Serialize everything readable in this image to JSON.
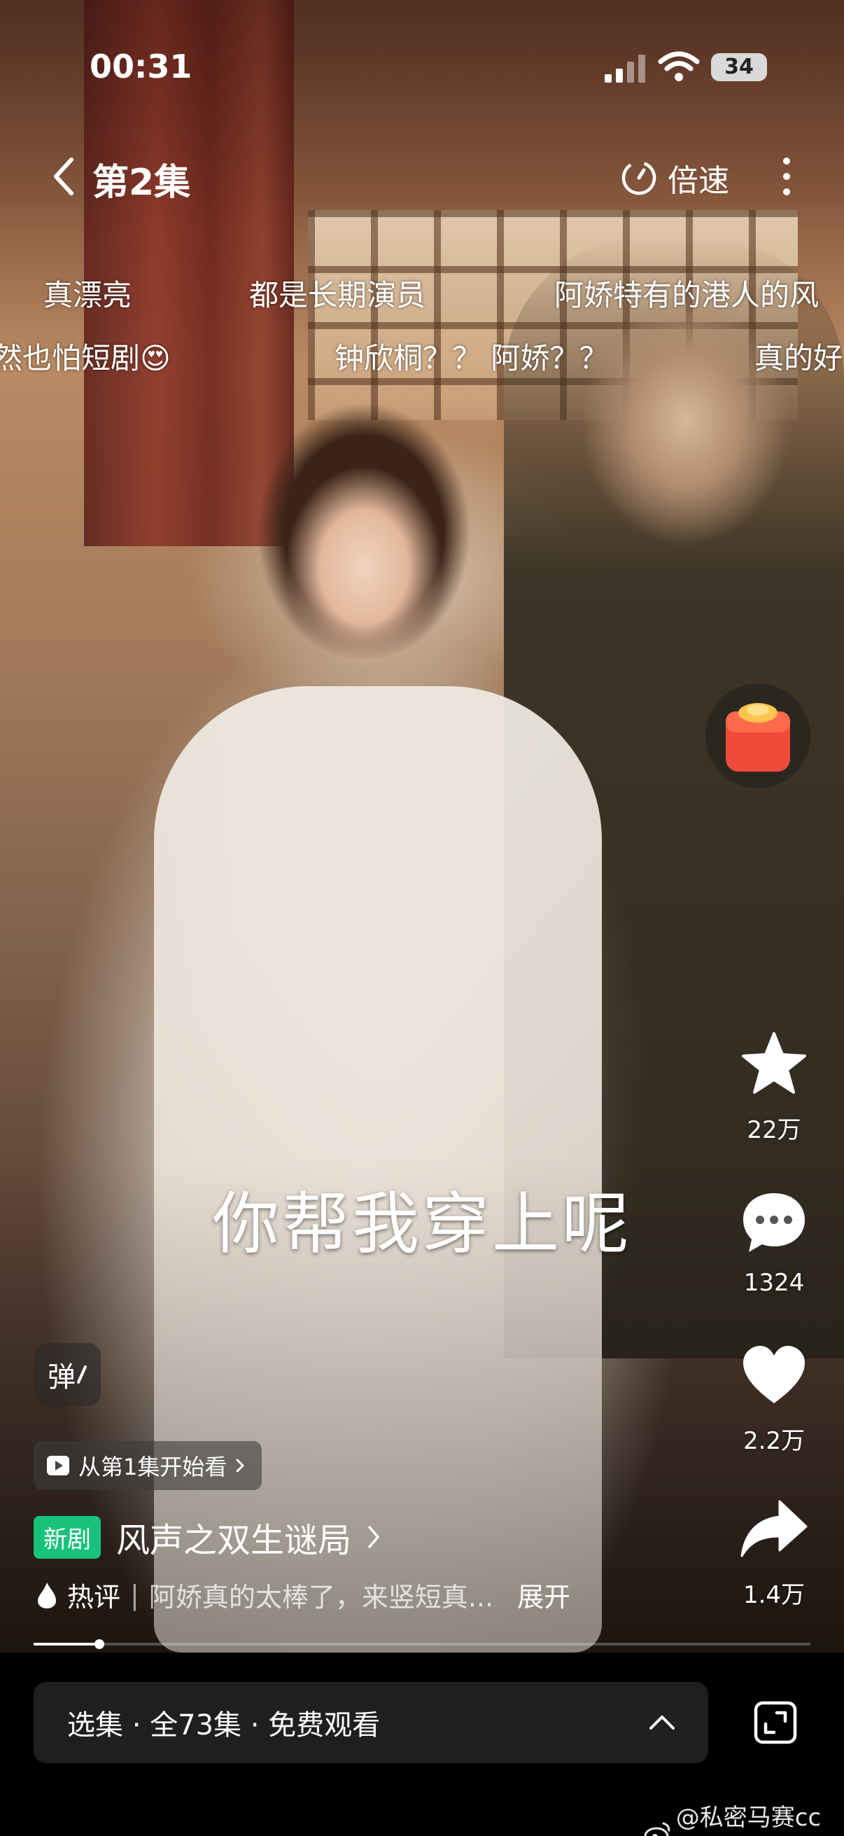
{
  "status_bar": {
    "time": "00:31",
    "battery": "34"
  },
  "top_bar": {
    "episode_title": "第2集",
    "speed_label": "倍速"
  },
  "danmaku": [
    {
      "text": "真漂亮"
    },
    {
      "text": "都是长期演员"
    },
    {
      "text": "阿娇特有的港人的风"
    },
    {
      "text": "然也怕短剧😍"
    },
    {
      "text": "钟欣桐？？ 阿娇？？"
    },
    {
      "text": "真的好"
    }
  ],
  "subtitle": "你帮我穿上呢",
  "actions": {
    "favorite_count": "22万",
    "comment_count": "1324",
    "like_count": "2.2万",
    "share_count": "1.4万"
  },
  "danmu_toggle_label": "弹",
  "from_first_label": "从第1集开始看",
  "drama": {
    "badge": "新剧",
    "title": "风声之双生谜局"
  },
  "hot_comment": {
    "label": "热评",
    "text": "阿娇真的太棒了，来竖短真...",
    "expand": "展开"
  },
  "progress": {
    "played_fraction": 0.085
  },
  "bottom_bar": {
    "episodes_label": "选集 · 全73集 · 免费观看"
  },
  "watermark": "@私密马赛cc酱"
}
